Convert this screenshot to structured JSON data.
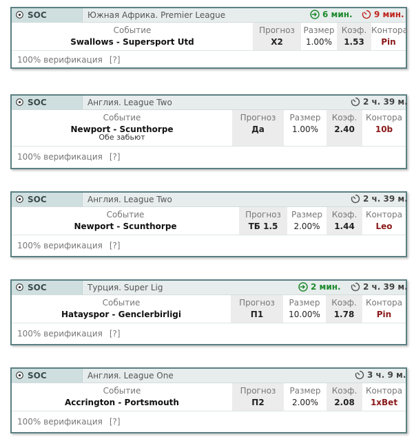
{
  "columns": {
    "event": "Событие",
    "forecast": "Прогноз",
    "size": "Размер",
    "coef": "Коэф.",
    "bookmaker": "Контора"
  },
  "verification": {
    "label": "100% верификация",
    "help": "[?]"
  },
  "sport": {
    "code": "SOC",
    "icon": "soccer-ball-icon"
  },
  "colors": {
    "header_bg": "#e7eded",
    "sport_cell_bg": "#cfdfe0",
    "border": "#5a7f82",
    "green": "#1e8a2e",
    "red": "#c0251f",
    "bookmaker": "#8b1a1a"
  },
  "bets": [
    {
      "league": "Южная Африка. Premier League",
      "time_start": "6 мин.",
      "time_end": "9 мин.",
      "event": "Swallows - Supersport Utd",
      "event_sub": "",
      "forecast": "X2",
      "size": "1.00%",
      "coef": "1.53",
      "bookmaker": "Pin"
    },
    {
      "league": "Англия. League Two",
      "time_end": "2 ч. 39 м.",
      "event": "Newport - Scunthorpe",
      "event_sub": "Обе забьют",
      "forecast": "Да",
      "size": "1.00%",
      "coef": "2.40",
      "bookmaker": "10b"
    },
    {
      "league": "Англия. League Two",
      "time_end": "2 ч. 39 м.",
      "event": "Newport - Scunthorpe",
      "event_sub": "",
      "forecast": "ТБ 1.5",
      "size": "2.00%",
      "coef": "1.44",
      "bookmaker": "Leo"
    },
    {
      "league": "Турция. Super Lig",
      "time_start": "2 мин.",
      "time_end": "2 ч. 39 м.",
      "event": "Hatayspor - Genclerbirligi",
      "event_sub": "",
      "forecast": "П1",
      "size": "10.00%",
      "coef": "1.78",
      "bookmaker": "Pin"
    },
    {
      "league": "Англия. League One",
      "time_end": "3 ч. 9 м.",
      "event": "Accrington - Portsmouth",
      "event_sub": "",
      "forecast": "П2",
      "size": "2.00%",
      "coef": "2.08",
      "bookmaker": "1xBet"
    }
  ]
}
